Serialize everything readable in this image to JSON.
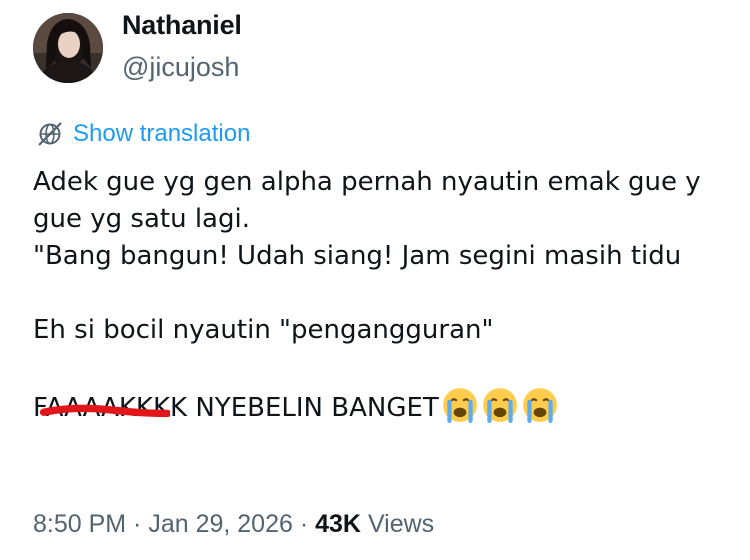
{
  "author": {
    "name": "Nathaniel",
    "handle": "@jicujosh"
  },
  "translate": {
    "label": "Show translation",
    "icon": "globe-icon",
    "color": "#1d9bf0"
  },
  "tweet": {
    "lines": [
      "Adek gue yg gen alpha pernah nyautin emak gue y",
      "gue yg satu lagi.",
      "\"Bang bangun! Udah siang! Jam segini masih tidu",
      "Eh si bocil nyautin \"pengangguran\""
    ],
    "last_line": {
      "struck": "FAAAAKKK",
      "rest": "K NYEBELIN BANGET"
    },
    "emoji": [
      "loudly-crying-face",
      "loudly-crying-face",
      "loudly-crying-face"
    ]
  },
  "meta": {
    "time": "8:50 PM",
    "sep1": " · ",
    "date": "Jan 29, 2026",
    "sep2": " · ",
    "views_count": "43K",
    "views_label": " Views"
  }
}
